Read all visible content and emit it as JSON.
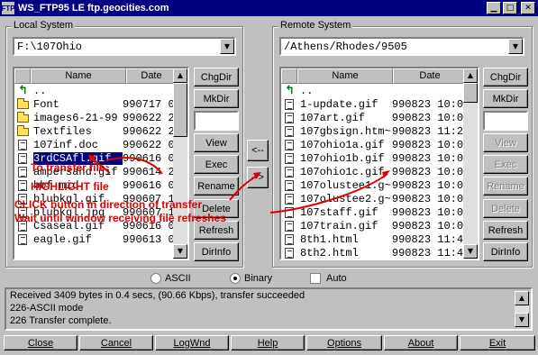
{
  "window": {
    "icon_text": "FTP",
    "title": "WS_FTP95 LE ftp.geocities.com",
    "controls": [
      "minimize-icon",
      "maximize-icon",
      "close-icon"
    ]
  },
  "local": {
    "group_label": "Local System",
    "path": "F:\\107Ohio",
    "columns": [
      "Name",
      "Date"
    ],
    "rows": [
      {
        "icon": "up-arrow-icon",
        "name": "..",
        "date": ""
      },
      {
        "icon": "folder-icon",
        "name": "Font",
        "date": "990717 0"
      },
      {
        "icon": "folder-icon",
        "name": "images6-21-99",
        "date": "990622 2"
      },
      {
        "icon": "folder-icon",
        "name": "Textfiles",
        "date": "990622 2"
      },
      {
        "icon": "file-icon",
        "name": "107inf.doc",
        "date": "990622 0"
      },
      {
        "icon": "file-icon",
        "name": "3rdCSAfl.gif",
        "date": "990616 0",
        "selected": true
      },
      {
        "icon": "file-icon",
        "name": "ampersand.gif",
        "date": "990614 2"
      },
      {
        "icon": "file-icon",
        "name": "bbf.mid",
        "date": "990616 0"
      },
      {
        "icon": "file-icon",
        "name": "blubkgl.gif",
        "date": "990607 1"
      },
      {
        "icon": "file-icon",
        "name": "blubkgl.jpg",
        "date": "990607 1"
      },
      {
        "icon": "file-icon",
        "name": "Csaseal.gif",
        "date": "990616 0"
      },
      {
        "icon": "file-icon",
        "name": "eagle.gif",
        "date": "990613 0"
      }
    ],
    "buttons": {
      "chgdir": "ChgDir",
      "mkdir": "MkDir",
      "view": "View",
      "exec": "Exec",
      "rename": "Rename",
      "delete": "Delete",
      "refresh": "Refresh",
      "dirinfo": "DirInfo"
    }
  },
  "remote": {
    "group_label": "Remote System",
    "path": "/Athens/Rhodes/9505",
    "columns": [
      "Name",
      "Date"
    ],
    "rows": [
      {
        "icon": "up-arrow-icon",
        "name": "..",
        "date": ""
      },
      {
        "icon": "file-icon",
        "name": "1-update.gif",
        "date": "990823 10:0"
      },
      {
        "icon": "file-icon",
        "name": "107art.gif",
        "date": "990823 10:0"
      },
      {
        "icon": "file-icon",
        "name": "107gbsign.htm~",
        "date": "990823 11:2"
      },
      {
        "icon": "file-icon",
        "name": "107ohio1a.gif",
        "date": "990823 10:0"
      },
      {
        "icon": "file-icon",
        "name": "107ohio1b.gif",
        "date": "990823 10:0"
      },
      {
        "icon": "file-icon",
        "name": "107ohio1c.gif",
        "date": "990823 10:0"
      },
      {
        "icon": "file-icon",
        "name": "107olustee1.g~",
        "date": "990823 10:0"
      },
      {
        "icon": "file-icon",
        "name": "107olustee2.g~",
        "date": "990823 10:0"
      },
      {
        "icon": "file-icon",
        "name": "107staff.gif",
        "date": "990823 10:0"
      },
      {
        "icon": "file-icon",
        "name": "107train.gif",
        "date": "990823 10:0"
      },
      {
        "icon": "file-icon",
        "name": "8th1.html",
        "date": "990823 11:4"
      },
      {
        "icon": "file-icon",
        "name": "8th2.html",
        "date": "990823 11:4"
      }
    ],
    "buttons": {
      "chgdir": "ChgDir",
      "mkdir": "MkDir",
      "view": "View",
      "exec": "Exec",
      "rename": "Rename",
      "delete": "Delete",
      "refresh": "Refresh",
      "dirinfo": "DirInfo"
    }
  },
  "transfer": {
    "to_local": "<--",
    "to_remote": "-->"
  },
  "mode": {
    "ascii": "ASCII",
    "binary": "Binary",
    "auto": "Auto",
    "selected": "binary",
    "auto_checked": false
  },
  "log": {
    "lines": [
      "Received 3409 bytes in 0.4 secs, (90.66 Kbps), transfer succeeded",
      "226-ASCII mode",
      "226 Transfer complete."
    ]
  },
  "bottom_buttons": [
    "Close",
    "Cancel",
    "LogWnd",
    "Help",
    "Options",
    "About",
    "Exit"
  ],
  "annotations": {
    "line1": "To transfer file:",
    "line2": "HIGHLIGHT file",
    "line3": "CLICK button in direction of transfer",
    "line4": "Wait until window receiving file refreshes",
    "color": "#e00000"
  }
}
